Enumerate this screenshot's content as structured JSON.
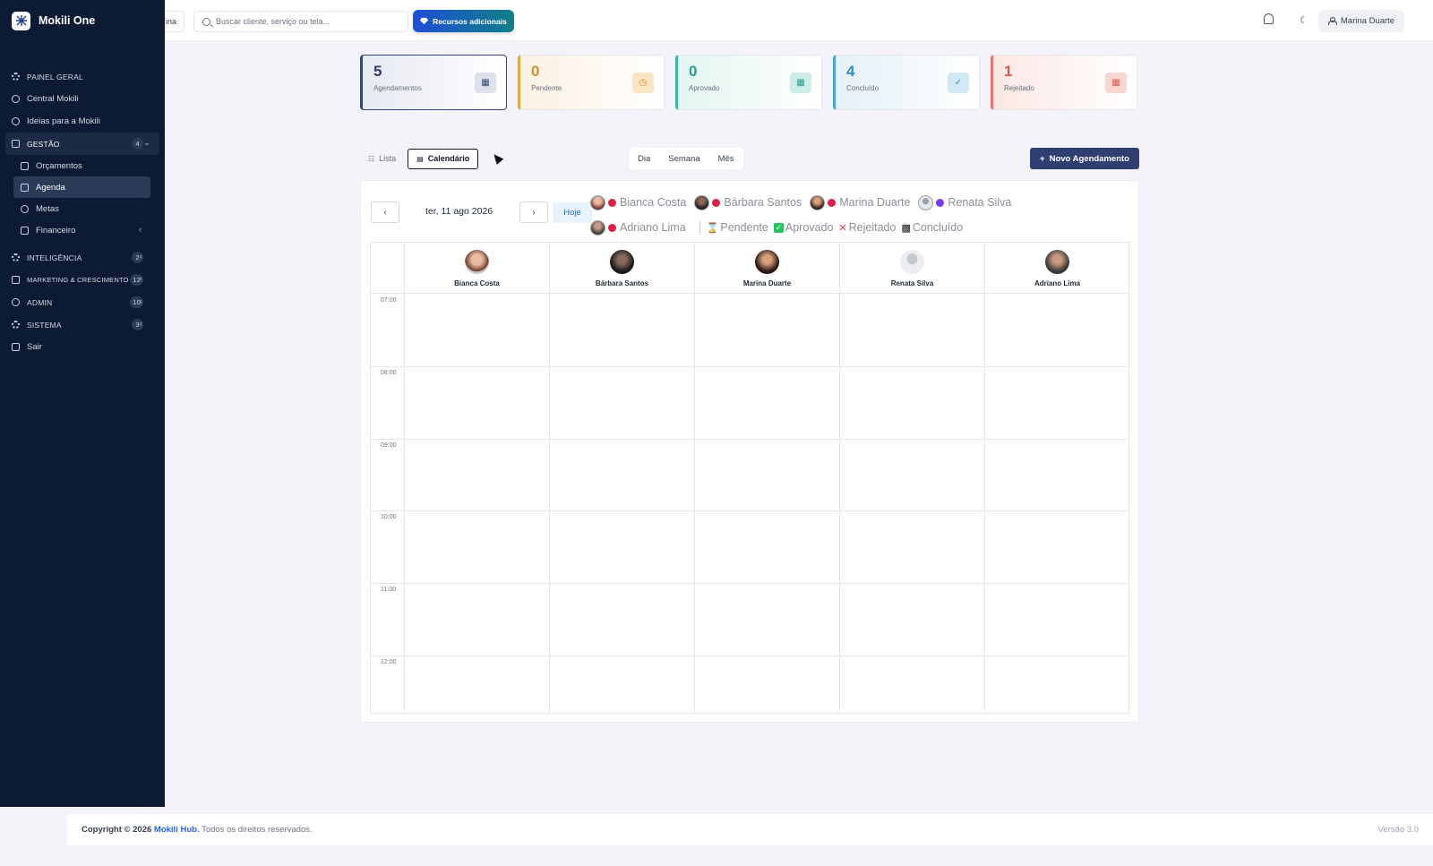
{
  "app": {
    "name": "Mokili One"
  },
  "sidebar": {
    "items": [
      {
        "label": "PAINEL GERAL"
      },
      {
        "label": "Central Mokili"
      },
      {
        "label": "Ideias para a Mokili"
      }
    ],
    "gestao": {
      "label": "GESTÃO",
      "badge": "4",
      "children": [
        {
          "label": "Orçamentos"
        },
        {
          "label": "Agenda"
        },
        {
          "label": "Metas"
        },
        {
          "label": "Financeiro"
        }
      ]
    },
    "sections": [
      {
        "label": "INTELIGÊNCIA",
        "badge": "2"
      },
      {
        "label": "MARKETING & CRESCIMENTO",
        "badge": "12"
      },
      {
        "label": "ADMIN",
        "badge": "10"
      },
      {
        "label": "SISTEMA",
        "badge": "3"
      }
    ],
    "logout": "Sair"
  },
  "topbar": {
    "crumb": "ina",
    "search_placeholder": "Buscar cliente, serviço ou tela...",
    "resources_label": "Recursos adicionais",
    "user_name": "Marina Duarte"
  },
  "stats": [
    {
      "value": "5",
      "label": "Agendamentos"
    },
    {
      "value": "0",
      "label": "Pendente"
    },
    {
      "value": "0",
      "label": "Aprovado"
    },
    {
      "value": "4",
      "label": "Concluído"
    },
    {
      "value": "1",
      "label": "Rejeitado"
    }
  ],
  "view": {
    "list_label": "Lista",
    "calendar_label": "Calendário",
    "periods": [
      "Dia",
      "Semana",
      "Mês"
    ],
    "new_label": "Novo Agendamento"
  },
  "calendar": {
    "prev": "‹",
    "next": "›",
    "date": "ter, 11 ago 2026",
    "today": "Hoje",
    "professionals": [
      {
        "name": "Bianca Costa",
        "color": "#e11d48"
      },
      {
        "name": "Bárbara Santos",
        "color": "#e11d48"
      },
      {
        "name": "Marina Duarte",
        "color": "#e11d48"
      },
      {
        "name": "Renata Silva",
        "color": "#7c3aed"
      },
      {
        "name": "Adriano Lima",
        "color": "#e11d48"
      }
    ],
    "statuses": [
      "Pendente",
      "Aprovado",
      "Rejeitado",
      "Concluído"
    ],
    "times": [
      "07:00",
      "08:00",
      "09:00",
      "10:00",
      "11:00",
      "12:00"
    ]
  },
  "footer": {
    "copyright": "Copyright © 2026",
    "brand": "Mokili Hub.",
    "rights": "Todos os direitos reservados.",
    "version": "Versão 3.0"
  }
}
